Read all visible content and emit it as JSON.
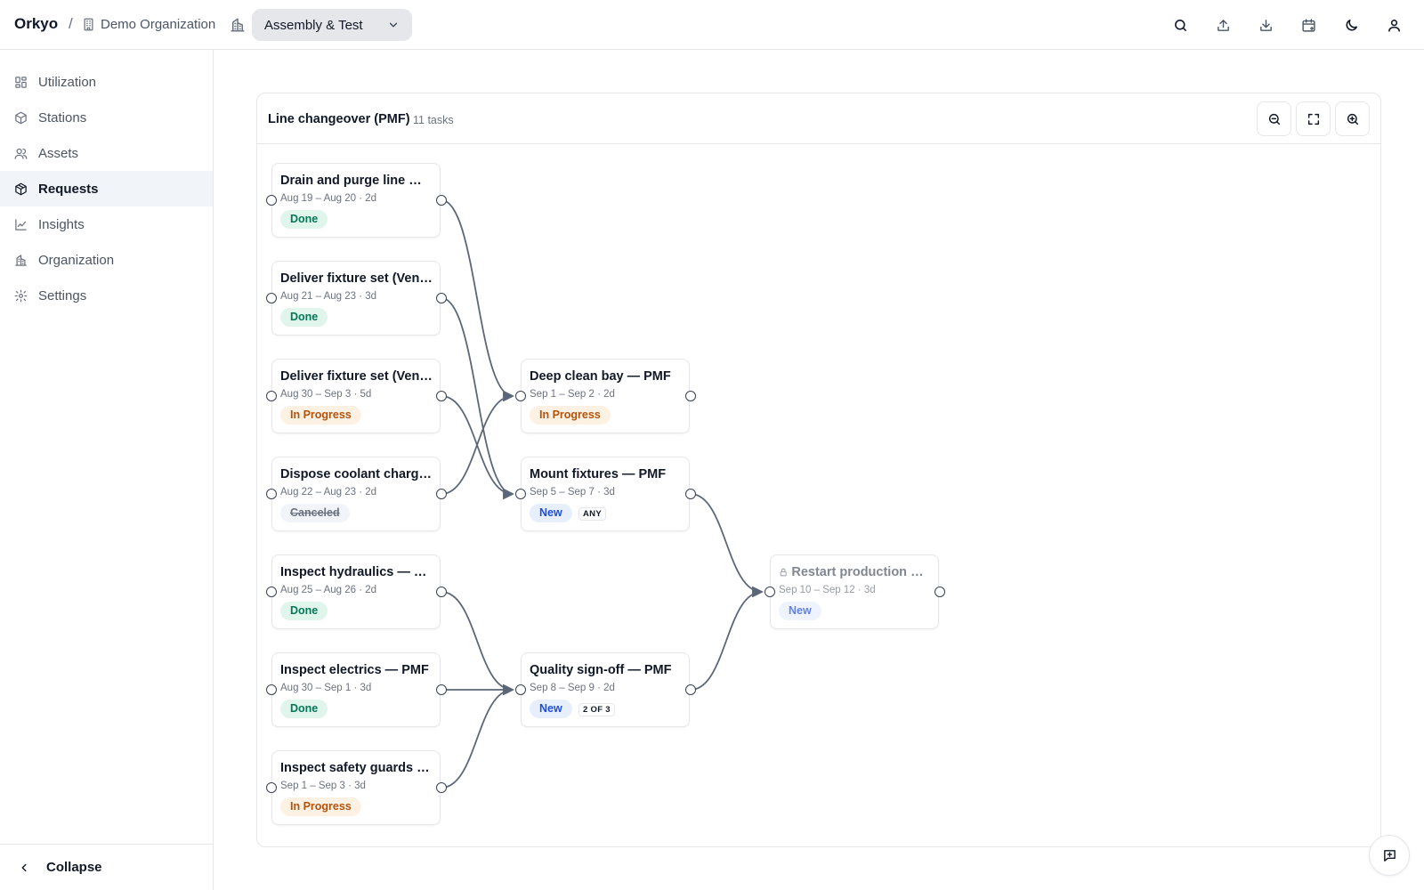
{
  "header": {
    "brand": "Orkyo",
    "separator": "/",
    "organization": "Demo Organization",
    "workspace": "Assembly & Test",
    "icons": [
      "search-icon",
      "upload-icon",
      "download-icon",
      "calendar-plus-icon",
      "moon-icon",
      "user-icon"
    ]
  },
  "sidebar": {
    "items": [
      {
        "label": "Utilization",
        "icon": "grid-icon"
      },
      {
        "label": "Stations",
        "icon": "cube-icon"
      },
      {
        "label": "Assets",
        "icon": "users-icon"
      },
      {
        "label": "Requests",
        "icon": "package-icon",
        "active": true
      },
      {
        "label": "Insights",
        "icon": "chart-icon"
      },
      {
        "label": "Organization",
        "icon": "building-icon"
      },
      {
        "label": "Settings",
        "icon": "gear-icon"
      }
    ],
    "collapse_label": "Collapse"
  },
  "panel": {
    "title": "Line changeover (PMF)",
    "count": "11 tasks"
  },
  "nodes": [
    {
      "title": "Drain and purge line — PMF",
      "dates": "Aug 19 – Aug 20 · 2d",
      "status": "Done",
      "status_type": "done"
    },
    {
      "title": "Deliver fixture set (Vendor A) — PMF",
      "dates": "Aug 21 – Aug 23 · 3d",
      "status": "Done",
      "status_type": "done"
    },
    {
      "title": "Deliver fixture set (Vendor B) — PMF",
      "dates": "Aug 30 – Sep 3 · 5d",
      "status": "In Progress",
      "status_type": "progress"
    },
    {
      "title": "Dispose coolant charge — PMF",
      "dates": "Aug 22 – Aug 23 · 2d",
      "status": "Canceled",
      "status_type": "canceled"
    },
    {
      "title": "Inspect hydraulics — PMF",
      "dates": "Aug 25 – Aug 26 · 2d",
      "status": "Done",
      "status_type": "done"
    },
    {
      "title": "Inspect electrics — PMF",
      "dates": "Aug 30 – Sep 1 · 3d",
      "status": "Done",
      "status_type": "done"
    },
    {
      "title": "Inspect safety guards — PMF",
      "dates": "Sep 1 – Sep 3 · 3d",
      "status": "In Progress",
      "status_type": "progress"
    },
    {
      "title": "Deep clean bay — PMF",
      "dates": "Sep 1 – Sep 2 · 2d",
      "status": "In Progress",
      "status_type": "progress"
    },
    {
      "title": "Mount fixtures — PMF",
      "dates": "Sep 5 – Sep 7 · 3d",
      "status": "New",
      "status_type": "new",
      "tag": "ANY"
    },
    {
      "title": "Quality sign-off — PMF",
      "dates": "Sep 8 – Sep 9 · 2d",
      "status": "New",
      "status_type": "new",
      "tag": "2 OF 3"
    },
    {
      "title": "Restart production — PMF",
      "dates": "Sep 10 – Sep 12 · 3d",
      "status": "New",
      "status_type": "new",
      "locked": true
    }
  ]
}
